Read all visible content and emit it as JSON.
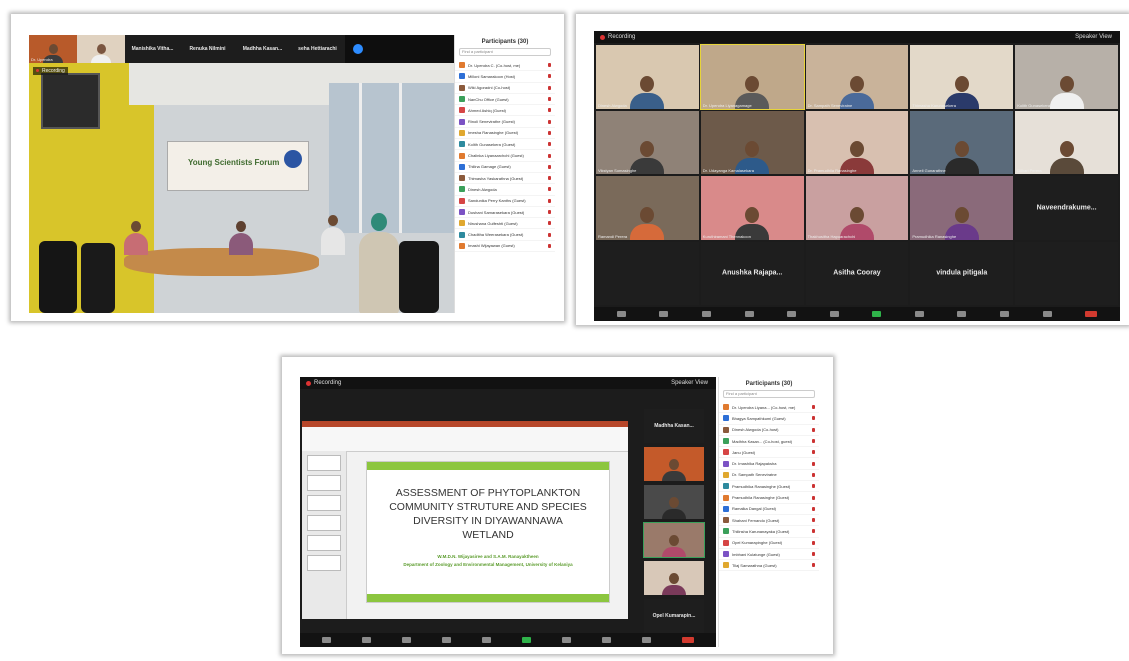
{
  "screen1": {
    "strip": [
      {
        "name": "Dr. Upendra"
      },
      {
        "name": ""
      },
      {
        "name": "Manishika Vitha..."
      },
      {
        "name": "Renuka Nilmini"
      },
      {
        "name": "Madhha Kasan..."
      },
      {
        "name": "seha Hettiarachi"
      }
    ],
    "recording": "Recording",
    "banner": "Young Scientists Forum",
    "participants_title": "Participants (30)",
    "search_placeholder": "Find a participant",
    "participants": [
      "Dr. Upendra C. (Co-host, me)",
      "Milloni Samarakoon (Host)",
      "Wiki Agoradni (Co-host)",
      "NanChu Office (Guest)",
      "Ahmed Ashiq (Guest)",
      "Rinoli Senevirathe (Guest)",
      "Imesha Ranasinghe (Guest)",
      "Kolith Gunasekera (Guest)",
      "Chalinka Liyanaarchchi (Guest)",
      "Thilina Gamage (Guest)",
      "Thimasha Yaskarathna (Guest)",
      "Dinesh Alwgoda",
      "Sandunika Perry Kanths (Guest)",
      "Dushani Samarasekara (Guest)",
      "Nirushana Gulfeshti (Guest)",
      "Chaditha Weerasekara (Guest)",
      "Imashi Wijayawan (Guest)"
    ]
  },
  "screen2": {
    "recording": "Recording",
    "speaker_view": "Speaker View",
    "tiles": [
      {
        "name": "Dinesh Alwgoda"
      },
      {
        "name": "Dr. Upendra Liyanagamage"
      },
      {
        "name": "Dr. Sampath Seneviratne"
      },
      {
        "name": "Thimasha Karunasekera"
      },
      {
        "name": "Kolith Gunasekera"
      },
      {
        "name": "Vikstyan Somasinghe"
      },
      {
        "name": "Dr. Udayanga Kamalasekara"
      },
      {
        "name": "Dr. Pramudhila Ranasinghe"
      },
      {
        "name": "Anneli Gunarathne"
      },
      {
        "name": "Dilhari Perera"
      },
      {
        "name": "Ramandi Perera"
      },
      {
        "name": "Kuruthiramani Thennakoon"
      },
      {
        "name": "Thakhusitha Hapuarachchi"
      },
      {
        "name": "Pramudhika Ranasinghe"
      },
      {
        "name": "Naveendrakume..."
      },
      {
        "name": ""
      },
      {
        "name": "Anushka Rajapa..."
      },
      {
        "name": "Asitha Cooray"
      },
      {
        "name": "vindula pitigala"
      },
      {
        "name": ""
      }
    ]
  },
  "screen3": {
    "recording": "Recording",
    "speaker_view": "Speaker View",
    "slide_title": "ASSESSMENT OF PHYTOPLANKTON COMMUNITY STRUTURE AND SPECIES DIVERSITY IN DIYAWANNAWA WETLAND",
    "slide_authors": "W.M.D.N. Wijayasiree and S.A.M. Ranayaktheen",
    "slide_affiliation": "Department of Zoology and Environmental Management, University of Kelaniya",
    "side_tiles": [
      {
        "name": "Madhha Kasan..."
      },
      {
        "name": ""
      },
      {
        "name": ""
      },
      {
        "name": ""
      },
      {
        "name": ""
      },
      {
        "name": "Opel Kumarapin..."
      }
    ],
    "participants_title": "Participants (30)",
    "search_placeholder": "Find a participant",
    "participants": [
      "Dr. Upendra Liyana... (Co-host, me)",
      "Bhagya Sampathkumi (Guest)",
      "Dinesh Alwgoda (Co-host)",
      "Madhha Kasan... (Co-host, guest)",
      "Janu (Guest)",
      "Dr. Imashika Rajapaksha",
      "Dr. Sampath Seneviratne",
      "Pramudhika Ranasinghe (Guest)",
      "Pramudhila Ranasinghe (Guest)",
      "Ramalka Dangal (Guest)",
      "Shahani Fernando (Guest)",
      "Thilinsha Karunanayaka (Guest)",
      "Opel Kumarapinghe (Guest)",
      "Imbhani Kulatunge (Guest)",
      "Tilaj Samarathna (Guest)"
    ]
  }
}
